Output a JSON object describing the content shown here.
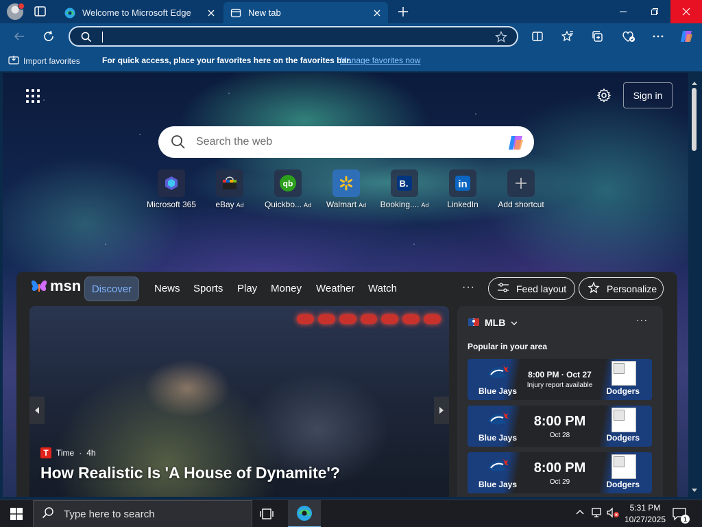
{
  "browser": {
    "tabs": [
      {
        "title": "Welcome to Microsoft Edge",
        "active": false
      },
      {
        "title": "New tab",
        "active": true
      }
    ],
    "address": {
      "value": ""
    },
    "favorites_bar": {
      "import_label": "Import favorites",
      "message": "For quick access, place your favorites here on the favorites bar.",
      "manage_link": "Manage favorites now"
    }
  },
  "newtab": {
    "sign_in": "Sign in",
    "search_placeholder": "Search the web",
    "shortcuts": [
      {
        "label": "Microsoft 365",
        "ad": "",
        "icon": "microsoft-365-icon"
      },
      {
        "label": "eBay",
        "ad": "Ad",
        "icon": "ebay-icon"
      },
      {
        "label": "Quickbo...",
        "ad": "Ad",
        "icon": "quickbooks-icon"
      },
      {
        "label": "Walmart",
        "ad": "Ad",
        "icon": "walmart-icon"
      },
      {
        "label": "Booking....",
        "ad": "Ad",
        "icon": "booking-icon"
      },
      {
        "label": "LinkedIn",
        "ad": "",
        "icon": "linkedin-icon"
      },
      {
        "label": "Add shortcut",
        "ad": "",
        "icon": "plus-icon"
      }
    ]
  },
  "msn": {
    "logo": "msn",
    "nav": [
      "Discover",
      "News",
      "Sports",
      "Play",
      "Money",
      "Weather",
      "Watch"
    ],
    "active_nav": "Discover",
    "feed_layout": "Feed layout",
    "personalize": "Personalize",
    "hero": {
      "source": "Time",
      "age": "4h",
      "headline": "How Realistic Is 'A House of Dynamite'?"
    },
    "sports": {
      "league": "MLB",
      "subtitle": "Popular in your area",
      "games": [
        {
          "home": "Blue Jays",
          "away": "Dodgers",
          "time": "8:00 PM · Oct 27",
          "note": "Injury report available"
        },
        {
          "home": "Blue Jays",
          "away": "Dodgers",
          "time": "8:00 PM",
          "note": "Oct 28"
        },
        {
          "home": "Blue Jays",
          "away": "Dodgers",
          "time": "8:00 PM",
          "note": "Oct 29"
        }
      ]
    }
  },
  "taskbar": {
    "search_placeholder": "Type here to search",
    "time": "5:31 PM",
    "date": "10/27/2025",
    "notifications": "1"
  },
  "colors": {
    "edge_blue": "#0f4d86",
    "close_red": "#e81123",
    "link": "#8cc2ff",
    "msn_accent": "#7fb3ff"
  }
}
